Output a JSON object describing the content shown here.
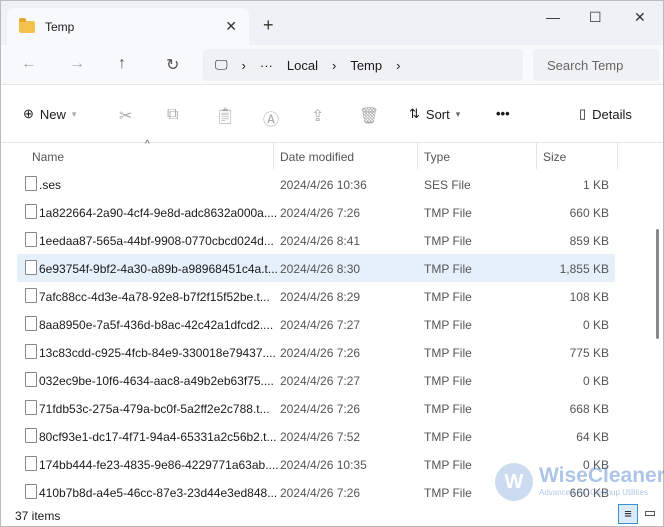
{
  "window": {
    "tab_title": "Temp",
    "new_tab": "+",
    "minimize": "—",
    "maximize": "☐",
    "close": "✕",
    "tab_close": "✕"
  },
  "nav": {
    "back": "←",
    "forward": "→",
    "up": "↑",
    "refresh": "↻",
    "breadcrumb": [
      "Local",
      "Temp"
    ],
    "more": "···",
    "search_placeholder": "Search Temp"
  },
  "toolbar": {
    "new": "New",
    "sort": "Sort",
    "more": "•••",
    "details": "Details"
  },
  "columns": [
    "Name",
    "Date modified",
    "Type",
    "Size"
  ],
  "files": [
    {
      "name": ".ses",
      "date": "2024/4/26 10:36",
      "type": "SES File",
      "size": "1 KB"
    },
    {
      "name": "1a822664-2a90-4cf4-9e8d-adc8632a000a....",
      "date": "2024/4/26 7:26",
      "type": "TMP File",
      "size": "660 KB"
    },
    {
      "name": "1eedaa87-565a-44bf-9908-0770cbcd024d...",
      "date": "2024/4/26 8:41",
      "type": "TMP File",
      "size": "859 KB"
    },
    {
      "name": "6e93754f-9bf2-4a30-a89b-a98968451c4a.t...",
      "date": "2024/4/26 8:30",
      "type": "TMP File",
      "size": "1,855 KB",
      "selected": true
    },
    {
      "name": "7afc88cc-4d3e-4a78-92e8-b7f2f15f52be.t...",
      "date": "2024/4/26 8:29",
      "type": "TMP File",
      "size": "108 KB"
    },
    {
      "name": "8aa8950e-7a5f-436d-b8ac-42c42a1dfcd2....",
      "date": "2024/4/26 7:27",
      "type": "TMP File",
      "size": "0 KB"
    },
    {
      "name": "13c83cdd-c925-4fcb-84e9-330018e79437....",
      "date": "2024/4/26 7:26",
      "type": "TMP File",
      "size": "775 KB"
    },
    {
      "name": "032ec9be-10f6-4634-aac8-a49b2eb63f75....",
      "date": "2024/4/26 7:27",
      "type": "TMP File",
      "size": "0 KB"
    },
    {
      "name": "71fdb53c-275a-479a-bc0f-5a2ff2e2c788.t...",
      "date": "2024/4/26 7:26",
      "type": "TMP File",
      "size": "668 KB"
    },
    {
      "name": "80cf93e1-dc17-4f71-94a4-65331a2c56b2.t...",
      "date": "2024/4/26 7:52",
      "type": "TMP File",
      "size": "64 KB"
    },
    {
      "name": "174bb444-fe23-4835-9e86-4229771a63ab....",
      "date": "2024/4/26 10:35",
      "type": "TMP File",
      "size": "0 KB"
    },
    {
      "name": "410b7b8d-a4e5-46cc-87e3-23d44e3ed848...",
      "date": "2024/4/26 7:26",
      "type": "TMP File",
      "size": "660 KB"
    }
  ],
  "status": {
    "count": "37 items"
  },
  "watermark": {
    "name": "WiseCleaner",
    "tagline": "Advanced PC Cleanup Utilities"
  },
  "colors": {
    "selected_row": "#e5f0fb",
    "folder": "#f3c24c"
  }
}
